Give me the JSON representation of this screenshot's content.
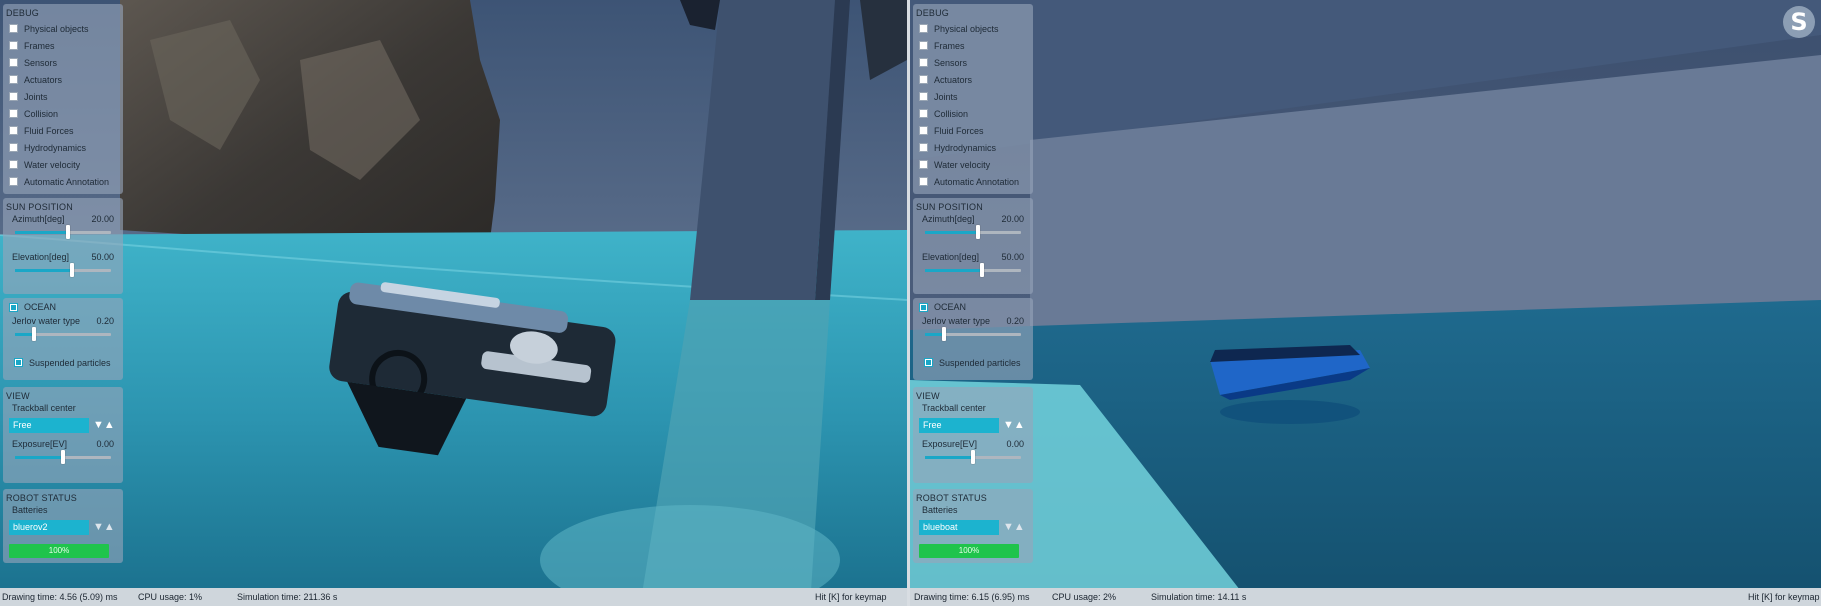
{
  "left_view": {
    "debug": {
      "header": "DEBUG",
      "options": [
        {
          "label": "Physical objects",
          "checked": false
        },
        {
          "label": "Frames",
          "checked": false
        },
        {
          "label": "Sensors",
          "checked": false
        },
        {
          "label": "Actuators",
          "checked": false
        },
        {
          "label": "Joints",
          "checked": false
        },
        {
          "label": "Collision",
          "checked": false
        },
        {
          "label": "Fluid Forces",
          "checked": false
        },
        {
          "label": "Hydrodynamics",
          "checked": false
        },
        {
          "label": "Water velocity",
          "checked": false
        },
        {
          "label": "Automatic Annotation",
          "checked": false
        }
      ]
    },
    "sun": {
      "header": "SUN POSITION",
      "azimuth_label": "Azimuth[deg]",
      "azimuth_value": "20.00",
      "azimuth_level": 0.55,
      "elevation_label": "Elevation[deg]",
      "elevation_value": "50.00",
      "elevation_level": 0.59
    },
    "ocean": {
      "header": "OCEAN",
      "enabled": true,
      "jerlov_label": "Jerlov water type",
      "jerlov_value": "0.20",
      "jerlov_level": 0.2,
      "particles_label": "Suspended particles",
      "particles_checked": true
    },
    "view": {
      "header": "VIEW",
      "trackball_label": "Trackball center",
      "trackball_value": "Free",
      "exposure_label": "Exposure[EV]",
      "exposure_value": "0.00",
      "exposure_level": 0.5
    },
    "robot": {
      "header": "ROBOT STATUS",
      "batteries_label": "Batteries",
      "robot_name": "bluerov2",
      "battery_text": "100%",
      "battery_level": 1.0
    },
    "status": {
      "drawing": "Drawing time: 4.56 (5.09) ms",
      "cpu": "CPU usage: 1%",
      "sim": "Simulation time: 211.36 s",
      "hint": "Hit [K] for keymap"
    }
  },
  "right_view": {
    "debug": {
      "header": "DEBUG",
      "options": [
        {
          "label": "Physical objects",
          "checked": false
        },
        {
          "label": "Frames",
          "checked": false
        },
        {
          "label": "Sensors",
          "checked": false
        },
        {
          "label": "Actuators",
          "checked": false
        },
        {
          "label": "Joints",
          "checked": false
        },
        {
          "label": "Collision",
          "checked": false
        },
        {
          "label": "Fluid Forces",
          "checked": false
        },
        {
          "label": "Hydrodynamics",
          "checked": false
        },
        {
          "label": "Water velocity",
          "checked": false
        },
        {
          "label": "Automatic Annotation",
          "checked": false
        }
      ]
    },
    "sun": {
      "header": "SUN POSITION",
      "azimuth_label": "Azimuth[deg]",
      "azimuth_value": "20.00",
      "azimuth_level": 0.55,
      "elevation_label": "Elevation[deg]",
      "elevation_value": "50.00",
      "elevation_level": 0.59
    },
    "ocean": {
      "header": "OCEAN",
      "enabled": true,
      "jerlov_label": "Jerlov water type",
      "jerlov_value": "0.20",
      "jerlov_level": 0.2,
      "particles_label": "Suspended particles",
      "particles_checked": true
    },
    "view": {
      "header": "VIEW",
      "trackball_label": "Trackball center",
      "trackball_value": "Free",
      "exposure_label": "Exposure[EV]",
      "exposure_value": "0.00",
      "exposure_level": 0.5
    },
    "robot": {
      "header": "ROBOT STATUS",
      "batteries_label": "Batteries",
      "robot_name": "blueboat",
      "battery_text": "100%",
      "battery_level": 1.0
    },
    "status": {
      "drawing": "Drawing time: 6.15 (6.95) ms",
      "cpu": "CPU usage: 2%",
      "sim": "Simulation time: 14.11 s",
      "hint": "Hit [K] for keymap"
    }
  },
  "logo_letter": "S",
  "colors": {
    "accent": "#1aa7c7",
    "battery": "#1fc44c",
    "water": "#2fa8c0"
  }
}
